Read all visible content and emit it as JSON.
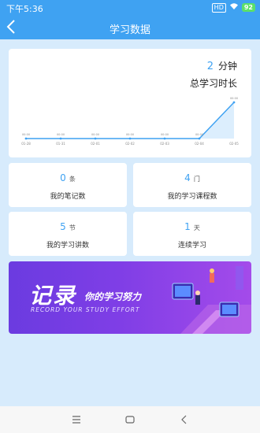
{
  "status_bar": {
    "time": "下午5:36",
    "sim_badge": "HD",
    "wifi": "wifi",
    "battery": "92"
  },
  "header": {
    "title": "学习数据",
    "back_icon": "chevron-left-icon"
  },
  "summary": {
    "total_value": "2",
    "total_unit": "分钟",
    "total_label": "总学习时长"
  },
  "chart_data": {
    "type": "line",
    "x": [
      "01-28",
      "01-31",
      "02-01",
      "02-02",
      "02-03",
      "02-04",
      "02-05"
    ],
    "tick_labels": [
      "01-28",
      "01-31",
      "02-01",
      "02-02",
      "02-03",
      "02-04",
      "02-05"
    ],
    "values": [
      0,
      0,
      0,
      0,
      0,
      0,
      2
    ],
    "point_labels": [
      "00:00",
      "00:00",
      "00:00",
      "00:00",
      "00:00",
      "00:00",
      "00:00"
    ],
    "ylim": [
      0,
      2
    ],
    "color": "#3fa2f2",
    "area": true,
    "grid": false
  },
  "stats": [
    {
      "value": "0",
      "unit": "条",
      "label": "我的笔记数"
    },
    {
      "value": "4",
      "unit": "门",
      "label": "我的学习课程数"
    },
    {
      "value": "5",
      "unit": "节",
      "label": "我的学习讲数"
    },
    {
      "value": "1",
      "unit": "天",
      "label": "连续学习"
    }
  ],
  "banner": {
    "title_big": "记录",
    "title_sub": "你的学习努力",
    "subtitle_en": "RECORD YOUR STUDY EFFORT"
  },
  "bottom_nav": {
    "menu_icon": "menu-icon",
    "home_icon": "square-home-icon",
    "back_icon": "triangle-back-icon"
  },
  "colors": {
    "primary": "#3fa2f2",
    "background": "#d7ebfc",
    "banner_start": "#6b3be0",
    "banner_end": "#a44bea"
  }
}
